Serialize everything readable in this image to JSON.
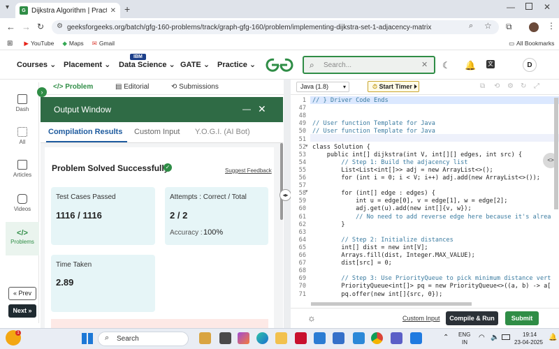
{
  "browser": {
    "tab_title": "Dijkstra Algorithm | Practice | G",
    "url": "geeksforgeeks.org/batch/gfg-160-problems/track/graph-gfg-160/problem/implementing-dijkstra-set-1-adjacency-matrix",
    "bookmarks": [
      "YouTube",
      "Maps",
      "Gmail"
    ],
    "all_bookmarks": "All Bookmarks"
  },
  "site_nav": {
    "items": [
      "Courses",
      "Placement",
      "Data Science",
      "GATE",
      "Practice"
    ],
    "badge": "IBM",
    "search_placeholder": "Search...",
    "avatar": "D"
  },
  "rail": {
    "items": [
      "Dash",
      "All",
      "Articles",
      "Videos",
      "Problems"
    ],
    "prev": "Prev",
    "next": "Next"
  },
  "problem_tabs": [
    "Problem",
    "Editorial",
    "Submissions"
  ],
  "output": {
    "title": "Output Window",
    "tabs": [
      "Compilation Results",
      "Custom Input",
      "Y.O.G.I. (AI Bot)"
    ],
    "status": "Problem Solved Successfully",
    "suggest": "Suggest Feedback",
    "test_cases_label": "Test Cases Passed",
    "test_cases_value": "1116 / 1116",
    "attempts_label": "Attempts : Correct / Total",
    "attempts_value": "2 / 2",
    "accuracy_label": "Accuracy :",
    "accuracy_value": "100%",
    "time_label": "Time Taken",
    "time_value": "2.89"
  },
  "editor": {
    "language": "Java (1.8)",
    "timer": "Start Timer",
    "custom_input": "Custom Input",
    "compile_run": "Compile & Run",
    "submit": "Submit",
    "lines": [
      {
        "n": "1",
        "code": "// } Driver Code Ends"
      },
      {
        "n": "47",
        "code": ""
      },
      {
        "n": "48",
        "code": ""
      },
      {
        "n": "49",
        "code": "// User function Template for Java"
      },
      {
        "n": "50",
        "code": "// User function Template for Java"
      },
      {
        "n": "51",
        "code": ""
      },
      {
        "n": "52",
        "code": "class Solution {"
      },
      {
        "n": "53",
        "code": "    public int[] dijkstra(int V, int[][] edges, int src) {"
      },
      {
        "n": "54",
        "code": "        // Step 1: Build the adjacency list"
      },
      {
        "n": "55",
        "code": "        List<List<int[]>> adj = new ArrayList<>();"
      },
      {
        "n": "56",
        "code": "        for (int i = 0; i < V; i++) adj.add(new ArrayList<>());"
      },
      {
        "n": "57",
        "code": ""
      },
      {
        "n": "58",
        "code": "        for (int[] edge : edges) {"
      },
      {
        "n": "59",
        "code": "            int u = edge[0], v = edge[1], w = edge[2];"
      },
      {
        "n": "60",
        "code": "            adj.get(u).add(new int[]{v, w});"
      },
      {
        "n": "61",
        "code": "            // No need to add reverse edge here because it's alrea"
      },
      {
        "n": "62",
        "code": "        }"
      },
      {
        "n": "63",
        "code": ""
      },
      {
        "n": "64",
        "code": "        // Step 2: Initialize distances"
      },
      {
        "n": "65",
        "code": "        int[] dist = new int[V];"
      },
      {
        "n": "66",
        "code": "        Arrays.fill(dist, Integer.MAX_VALUE);"
      },
      {
        "n": "67",
        "code": "        dist[src] = 0;"
      },
      {
        "n": "68",
        "code": ""
      },
      {
        "n": "69",
        "code": "        // Step 3: Use PriorityQueue to pick minimum distance vert"
      },
      {
        "n": "70",
        "code": "        PriorityQueue<int[]> pq = new PriorityQueue<>((a, b) -> a["
      },
      {
        "n": "71",
        "code": "        pq.offer(new int[]{src, 0});"
      }
    ]
  },
  "taskbar": {
    "search": "Search",
    "lang_top": "ENG",
    "lang_bottom": "IN",
    "time": "19:14",
    "date": "23-04-2025"
  },
  "colors": {
    "brand_green": "#2f8d46",
    "output_header": "#2f6b45",
    "card_bg": "#e6f5f7"
  }
}
